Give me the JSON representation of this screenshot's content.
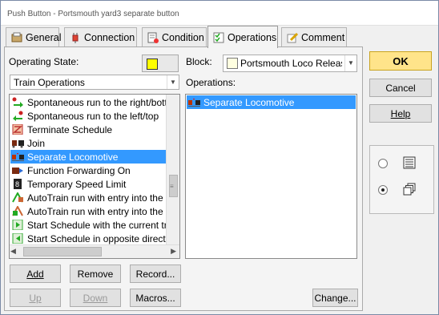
{
  "window": {
    "title": "Push Button - Portsmouth yard3 separate button"
  },
  "tabs": [
    {
      "label": "General",
      "icon": "general-icon"
    },
    {
      "label": "Connection",
      "icon": "plug-icon"
    },
    {
      "label": "Condition",
      "icon": "condition-icon"
    },
    {
      "label": "Operations",
      "icon": "operations-icon",
      "active": true
    },
    {
      "label": "Comment",
      "icon": "pencil-icon"
    }
  ],
  "operating_state": {
    "label": "Operating State:",
    "color": "#ffff00",
    "selected": "Train Operations"
  },
  "operation_list": {
    "items": [
      {
        "label": "Spontaneous run to the right/bottom",
        "icon": "arrow-right-icon"
      },
      {
        "label": "Spontaneous run to the left/top",
        "icon": "arrow-left-icon"
      },
      {
        "label": "Terminate Schedule",
        "icon": "terminate-schedule-icon"
      },
      {
        "label": "Join",
        "icon": "join-icon"
      },
      {
        "label": "Separate Locomotive",
        "icon": "separate-locomotive-icon",
        "selected": true
      },
      {
        "label": "Function Forwarding On",
        "icon": "function-forwarding-icon"
      },
      {
        "label": "Temporary Speed Limit",
        "icon": "speed-limit-icon"
      },
      {
        "label": "AutoTrain run with entry into the desti",
        "icon": "autotrain-icon"
      },
      {
        "label": "AutoTrain run with entry into the desti",
        "icon": "autotrain-icon"
      },
      {
        "label": "Start Schedule with the current train",
        "icon": "start-schedule-icon"
      },
      {
        "label": "Start Schedule in opposite direction wit",
        "icon": "start-schedule-icon"
      }
    ]
  },
  "block": {
    "label": "Block:",
    "selected": "Portsmouth Loco Release I",
    "color": "#ffffe0"
  },
  "operations": {
    "label": "Operations:",
    "items": [
      {
        "label": "Separate Locomotive",
        "icon": "separate-locomotive-icon",
        "selected": true
      }
    ]
  },
  "buttons": {
    "add": "Add",
    "remove": "Remove",
    "record": "Record...",
    "up": "Up",
    "down": "Down",
    "macros": "Macros...",
    "change": "Change...",
    "ok": "OK",
    "cancel": "Cancel",
    "help": "Help"
  },
  "view_mode": {
    "options": [
      {
        "icon": "list-view-icon",
        "selected": false
      },
      {
        "icon": "cascade-view-icon",
        "selected": true
      }
    ]
  }
}
